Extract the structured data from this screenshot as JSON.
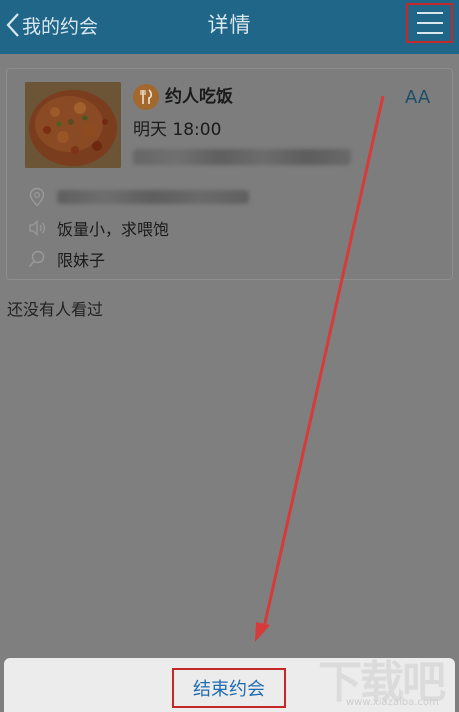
{
  "header": {
    "back_label": "我的约会",
    "title": "详情"
  },
  "card": {
    "category": "约人吃饭",
    "font_toggle": "AA",
    "time": "明天 18:00",
    "note": "饭量小，求喂饱",
    "requirement": "限妹子",
    "category_color": "#a3682e"
  },
  "viewers": {
    "empty_text": "还没有人看过"
  },
  "action_sheet": {
    "end_label": "结束约会"
  },
  "watermark": {
    "logo": "下载吧",
    "url": "www.xiazaiba.com"
  },
  "colors": {
    "header_bg": "#1f6688",
    "highlight": "#c62828",
    "accent": "#1f6bb0"
  }
}
